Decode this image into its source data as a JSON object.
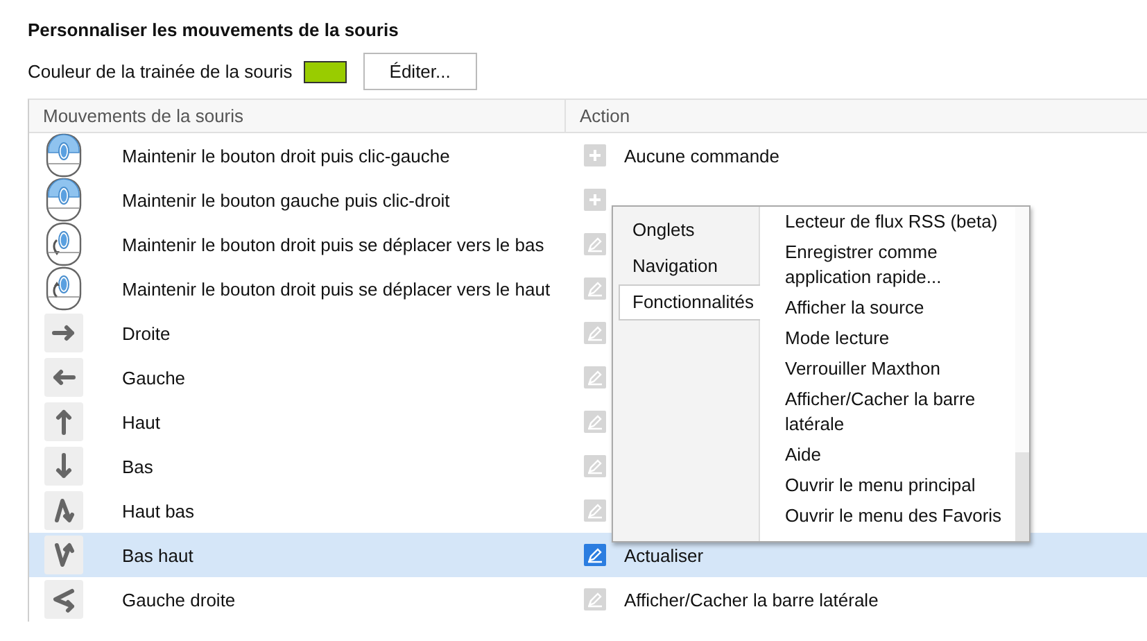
{
  "title": "Personnaliser les mouvements de la souris",
  "trail": {
    "label": "Couleur de la trainée de la souris",
    "color": "#99cc00",
    "button": "Éditer..."
  },
  "table": {
    "columns": [
      "Mouvements de la souris",
      "Action"
    ],
    "rows": [
      {
        "kind": "rightclick",
        "gesture": "Maintenir le bouton droit puis clic-gauche",
        "assigned": false,
        "action": "Aucune commande",
        "selected": false
      },
      {
        "kind": "leftclick",
        "gesture": "Maintenir le bouton gauche puis clic-droit",
        "assigned": false,
        "selected": false
      },
      {
        "kind": "wheeldown",
        "gesture": "Maintenir le bouton droit puis se déplacer vers le bas",
        "assigned": true,
        "selected": false
      },
      {
        "kind": "wheelup",
        "gesture": "Maintenir le bouton droit puis se déplacer vers le haut",
        "assigned": true,
        "selected": false
      },
      {
        "kind": "right",
        "gesture": "Droite",
        "assigned": true,
        "selected": false
      },
      {
        "kind": "left",
        "gesture": "Gauche",
        "assigned": true,
        "selected": false
      },
      {
        "kind": "up",
        "gesture": "Haut",
        "assigned": true,
        "selected": false
      },
      {
        "kind": "down",
        "gesture": "Bas",
        "assigned": true,
        "selected": false
      },
      {
        "kind": "updown",
        "gesture": "Haut bas",
        "assigned": true,
        "selected": false
      },
      {
        "kind": "downup",
        "gesture": "Bas haut",
        "assigned": true,
        "action": "Actualiser",
        "selected": true
      },
      {
        "kind": "leftright",
        "gesture": "Gauche droite",
        "assigned": true,
        "action": "Afficher/Cacher la barre latérale",
        "selected": false
      }
    ]
  },
  "menu": {
    "tabs": [
      {
        "label": "Onglets",
        "selected": false
      },
      {
        "label": "Navigation",
        "selected": false
      },
      {
        "label": "Fonctionnalités",
        "selected": true
      }
    ],
    "items": [
      "Lecteur de flux RSS (beta)",
      "Enregistrer comme application rapide...",
      "Afficher la source",
      "Mode lecture",
      "Verrouiller Maxthon",
      "Afficher/Cacher la barre latérale",
      "Aide",
      "Ouvrir le menu principal",
      "Ouvrir le menu des Favoris"
    ]
  }
}
